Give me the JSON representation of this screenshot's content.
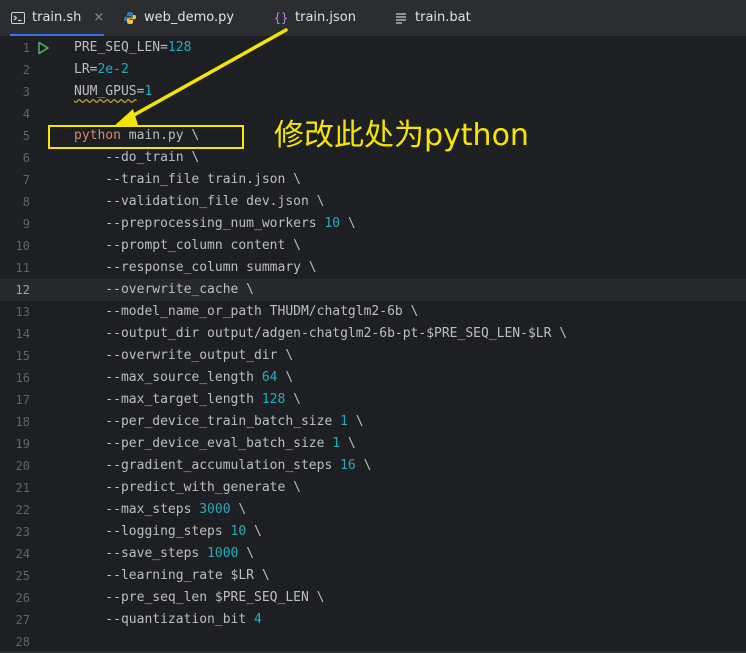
{
  "tabs": [
    {
      "label": "train.sh",
      "icon": "terminal-icon",
      "active": true,
      "closable": true
    },
    {
      "label": "web_demo.py",
      "icon": "python-icon",
      "active": false
    },
    {
      "label": "train.json",
      "icon": "json-braces-icon",
      "active": false
    },
    {
      "label": "train.bat",
      "icon": "text-file-icon",
      "active": false
    }
  ],
  "tab_close_glyph": "×",
  "editor": {
    "current_line": 12,
    "lines": [
      {
        "n": "1",
        "text": "PRE_SEQ_LEN=128"
      },
      {
        "n": "2",
        "text": "LR=2e-2"
      },
      {
        "n": "3",
        "text": "NUM_GPUS=1"
      },
      {
        "n": "4",
        "text": ""
      },
      {
        "n": "5",
        "text": "python main.py \\"
      },
      {
        "n": "6",
        "text": "    --do_train \\"
      },
      {
        "n": "7",
        "text": "    --train_file train.json \\"
      },
      {
        "n": "8",
        "text": "    --validation_file dev.json \\"
      },
      {
        "n": "9",
        "text": "    --preprocessing_num_workers 10 \\"
      },
      {
        "n": "10",
        "text": "    --prompt_column content \\"
      },
      {
        "n": "11",
        "text": "    --response_column summary \\"
      },
      {
        "n": "12",
        "text": "    --overwrite_cache \\"
      },
      {
        "n": "13",
        "text": "    --model_name_or_path THUDM/chatglm2-6b \\"
      },
      {
        "n": "14",
        "text": "    --output_dir output/adgen-chatglm2-6b-pt-$PRE_SEQ_LEN-$LR \\"
      },
      {
        "n": "15",
        "text": "    --overwrite_output_dir \\"
      },
      {
        "n": "16",
        "text": "    --max_source_length 64 \\"
      },
      {
        "n": "17",
        "text": "    --max_target_length 128 \\"
      },
      {
        "n": "18",
        "text": "    --per_device_train_batch_size 1 \\"
      },
      {
        "n": "19",
        "text": "    --per_device_eval_batch_size 1 \\"
      },
      {
        "n": "20",
        "text": "    --gradient_accumulation_steps 16 \\"
      },
      {
        "n": "21",
        "text": "    --predict_with_generate \\"
      },
      {
        "n": "22",
        "text": "    --max_steps 3000 \\"
      },
      {
        "n": "23",
        "text": "    --logging_steps 10 \\"
      },
      {
        "n": "24",
        "text": "    --save_steps 1000 \\"
      },
      {
        "n": "25",
        "text": "    --learning_rate $LR \\"
      },
      {
        "n": "26",
        "text": "    --pre_seq_len $PRE_SEQ_LEN \\"
      },
      {
        "n": "27",
        "text": "    --quantization_bit 4"
      },
      {
        "n": "28",
        "text": ""
      }
    ]
  },
  "annotation": {
    "text": "修改此处为python",
    "color": "#f5e600"
  },
  "colors": {
    "editor_bg": "#1e1f22",
    "text": "#bcbec4",
    "number": "#2aacb8",
    "keyword": "#cf8e6d",
    "line_number": "#5f636b",
    "active_tab_underline": "#3574f0"
  }
}
